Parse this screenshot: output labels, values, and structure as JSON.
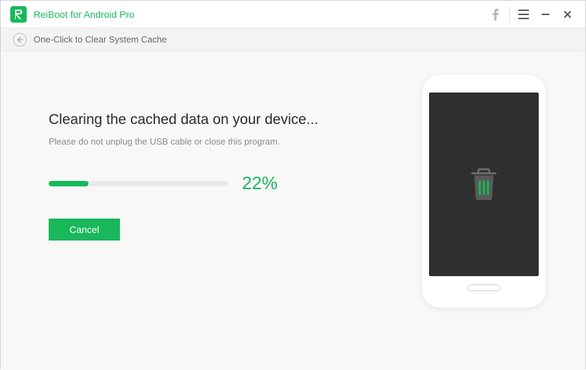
{
  "app": {
    "title": "ReiBoot for Android Pro"
  },
  "breadcrumb": {
    "text": "One-Click to Clear System Cache"
  },
  "main": {
    "heading": "Clearing the cached data on your device...",
    "subtext": "Please do not unplug the USB cable or close this program.",
    "progress_percent": 22,
    "progress_label": "22%",
    "cancel_label": "Cancel"
  },
  "colors": {
    "accent": "#18b85b"
  }
}
